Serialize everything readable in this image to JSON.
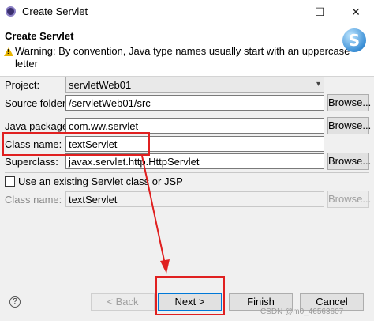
{
  "window": {
    "title": "Create Servlet",
    "controls": {
      "minimize": "—",
      "maximize": "☐",
      "close": "✕"
    }
  },
  "header": {
    "title": "Create Servlet",
    "warning": "Warning: By convention, Java type names usually start with an uppercase letter",
    "logo_letter": "S"
  },
  "form": {
    "project": {
      "label": "Project:",
      "value": "servletWeb01"
    },
    "source_folder": {
      "label": "Source folder:",
      "value": "/servletWeb01/src",
      "browse": "Browse..."
    },
    "java_package": {
      "label": "Java package:",
      "value": "com.ww.servlet",
      "browse": "Browse..."
    },
    "class_name": {
      "label": "Class name:",
      "value": "textServlet"
    },
    "superclass": {
      "label": "Superclass:",
      "value": "javax.servlet.http.HttpServlet",
      "browse": "Browse..."
    },
    "existing": {
      "label": "Use an existing Servlet class or JSP",
      "checked": false
    },
    "existing_class": {
      "label": "Class name:",
      "value": "textServlet",
      "browse": "Browse..."
    }
  },
  "footer": {
    "help_icon": "?",
    "back": "< Back",
    "next": "Next >",
    "finish": "Finish",
    "cancel": "Cancel"
  },
  "watermark": "CSDN @m0_46563607",
  "annotation_color": "#e02020"
}
